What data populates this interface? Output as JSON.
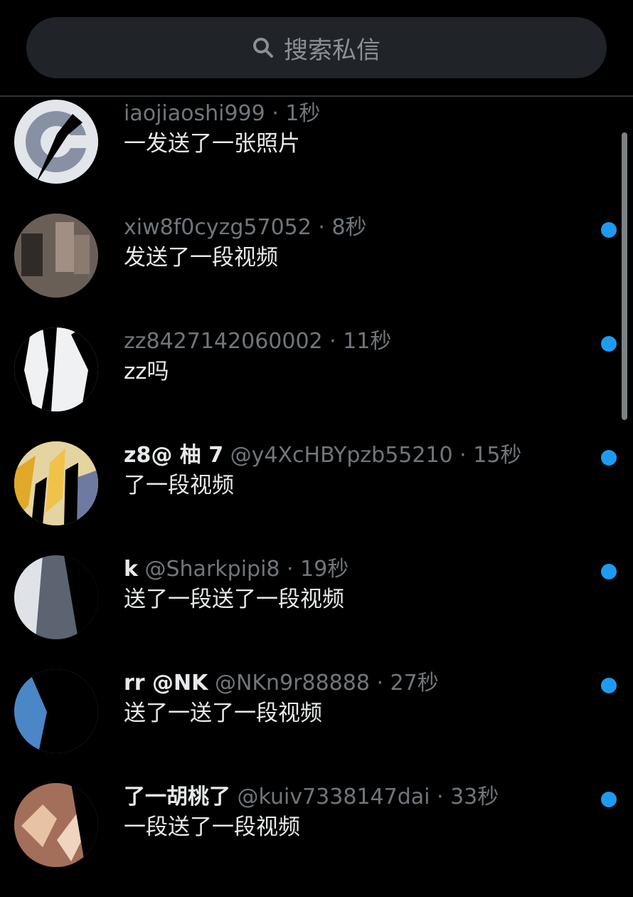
{
  "search": {
    "placeholder": "搜索私信"
  },
  "colors": {
    "background": "#000000",
    "unread_dot": "#1d9bf0",
    "text_muted": "#71767b",
    "text": "#e7e9ea"
  },
  "conversations": [
    {
      "name": "",
      "handle": "iaojiaoshi999",
      "time": "1秒",
      "preview": "一发送了一张照片",
      "unread": false
    },
    {
      "name": "",
      "handle": "xiw8f0cyzg57052",
      "time": "8秒",
      "preview": "发送了一段视频",
      "unread": true
    },
    {
      "name": "",
      "handle": "zz8427142060002",
      "time": "11秒",
      "preview": "zz吗",
      "unread": true
    },
    {
      "name": "z8@ 柚 7",
      "handle": "@y4XcHBYpzb55210",
      "time": "15秒",
      "preview": "了一段视频",
      "unread": true
    },
    {
      "name": "k",
      "handle": "@Sharkpipi8",
      "time": "19秒",
      "preview": "送了一段送了一段视频",
      "unread": true
    },
    {
      "name": "rr @NK",
      "handle": "@NKn9r88888",
      "time": "27秒",
      "preview": "送了一送了一段视频",
      "unread": true
    },
    {
      "name": "了一胡桃了",
      "handle": "@kuiv7338147dai",
      "time": "33秒",
      "preview": "一段送了一段视频",
      "unread": true
    }
  ]
}
